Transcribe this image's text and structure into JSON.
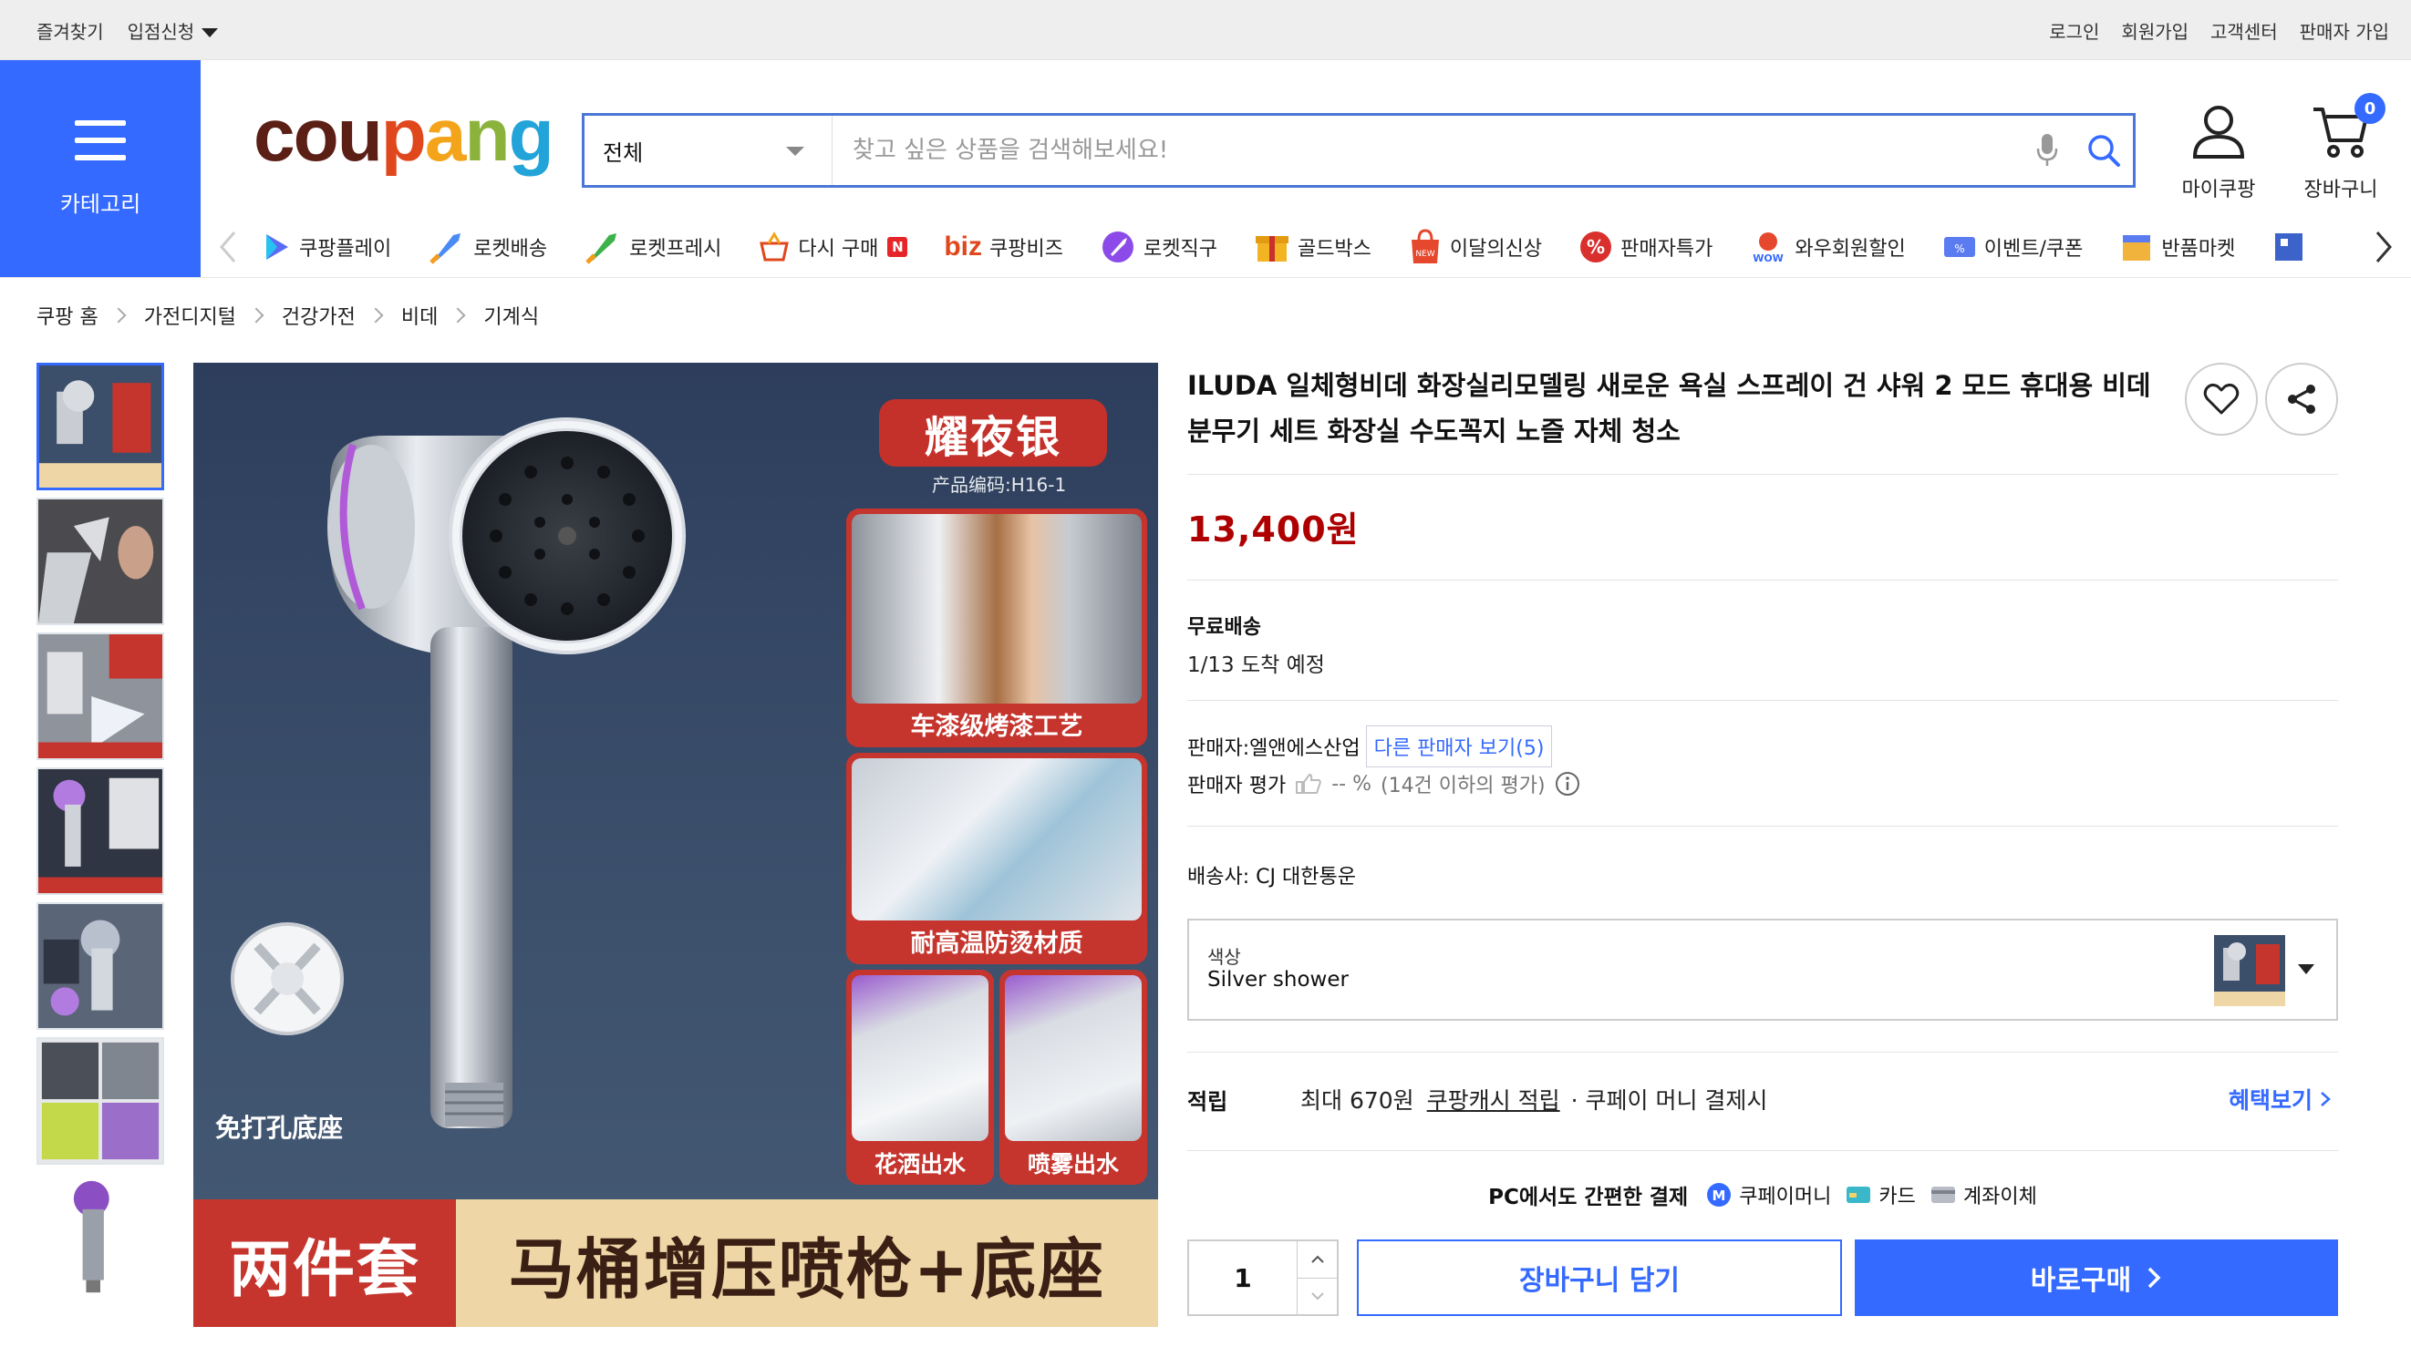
{
  "topbar": {
    "bookmark": "즐겨찾기",
    "apply": "입점신청",
    "login": "로그인",
    "signup": "회원가입",
    "support": "고객센터",
    "seller_signup": "판매자 가입"
  },
  "header": {
    "category_label": "카테고리",
    "logo": [
      "cou",
      "p",
      "a",
      "n",
      "g"
    ],
    "search_scope": "전체",
    "search_placeholder": "찾고 싶은 상품을 검색해보세요!",
    "my_coupang": "마이쿠팡",
    "cart": "장바구니",
    "cart_count": "0"
  },
  "nav": {
    "items": [
      {
        "label": "쿠팡플레이",
        "icon": "play-icon"
      },
      {
        "label": "로켓배송",
        "icon": "rocket-icon"
      },
      {
        "label": "로켓프레시",
        "icon": "rocket-fresh-icon"
      },
      {
        "label": "다시 구매",
        "icon": "rebuy-icon",
        "badge": "N"
      },
      {
        "label": "쿠팡비즈",
        "prefix": "biz"
      },
      {
        "label": "로켓직구",
        "icon": "global-rocket-icon"
      },
      {
        "label": "골드박스",
        "icon": "goldbox-icon"
      },
      {
        "label": "이달의신상",
        "icon": "new-icon"
      },
      {
        "label": "판매자특가",
        "icon": "percent-icon"
      },
      {
        "label": "와우회원할인",
        "icon": "wow-icon"
      },
      {
        "label": "이벤트/쿠폰",
        "icon": "coupon-icon"
      },
      {
        "label": "반품마켓",
        "icon": "return-market-icon"
      }
    ]
  },
  "breadcrumb": [
    "쿠팡 홈",
    "가전디지털",
    "건강가전",
    "비데",
    "기계식"
  ],
  "product": {
    "title": "ILUDA 일체형비데 화장실리모델링 새로운 욕실 스프레이 건 샤워 2 모드 휴대용 비데 분무기 세트 화장실 수도꼭지 노즐 자체 청소",
    "price": "13,400원",
    "shipping_title": "무료배송",
    "arrival": "1/13 도착 예정",
    "seller_label": "판매자:",
    "seller_name": "엘앤에스산업",
    "seller_other": "다른 판매자 보기(5)",
    "rating_label": "판매자 평가",
    "rating_value": "-- %",
    "rating_note": "(14건 이하의 평가)",
    "carrier_label": "배송사:",
    "carrier_name": "CJ 대한통운",
    "option_label": "색상",
    "option_value": "Silver shower",
    "reward_label": "적립",
    "reward_text": "최대 670원",
    "reward_link": "쿠팡캐시 적립",
    "reward_pay": "· 쿠페이 머니 결제시",
    "benefit_link": "혜택보기",
    "pay_title": "PC에서도 간편한 결제",
    "pay_methods": [
      "쿠페이머니",
      "카드",
      "계좌이체"
    ],
    "quantity": "1",
    "add_cart": "장바구니 담기",
    "buy_now": "바로구매"
  },
  "image_text": {
    "ribbon": "耀夜银",
    "code": "产品编码:H16-1",
    "panel1": "车漆级烤漆工艺",
    "panel2": "耐高温防烫材质",
    "panel3": "花洒出水",
    "panel4": "喷雾出水",
    "base": "免打孔底座",
    "banner_left": "两件套",
    "banner_right": "马桶增压喷枪+底座"
  },
  "colors": {
    "brand_blue": "#346aff",
    "price_red": "#ae0000",
    "panel_red": "#c5352e"
  }
}
